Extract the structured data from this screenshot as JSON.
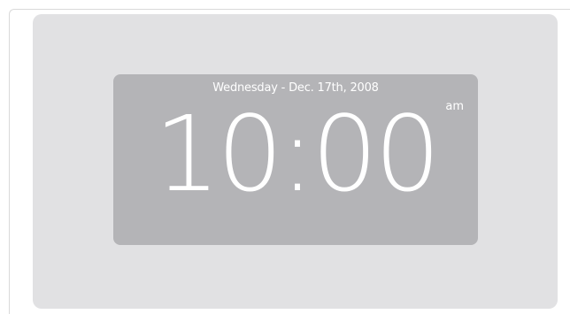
{
  "clock": {
    "date": "Wednesday - Dec. 17th, 2008",
    "time": "10:00",
    "period": "am"
  },
  "colors": {
    "page_background": "#ffffff",
    "panel": "#e1e1e3",
    "clock_background": "#b4b4b7",
    "text": "#ffffff"
  }
}
